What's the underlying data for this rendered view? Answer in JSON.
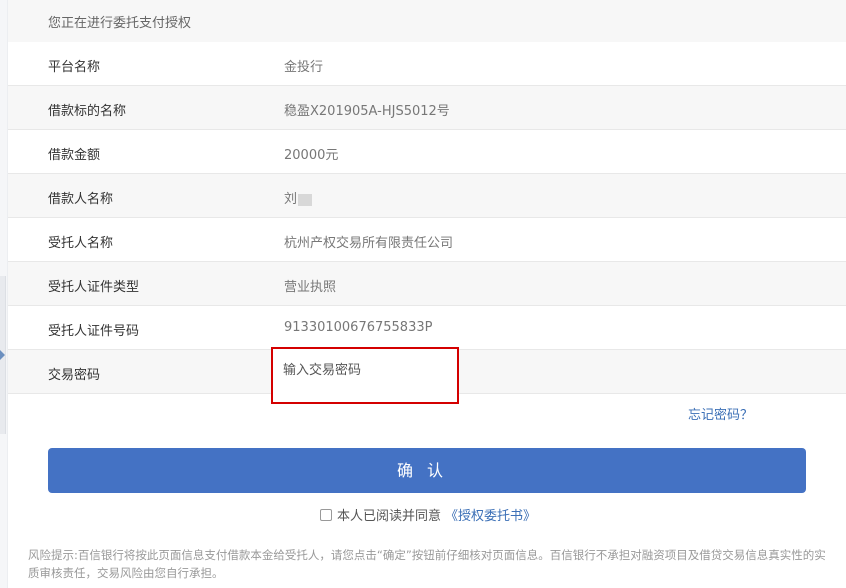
{
  "header": {
    "title": "您正在进行委托支付授权"
  },
  "rows": [
    {
      "label": "平台名称",
      "value": "金投行"
    },
    {
      "label": "借款标的名称",
      "value": "稳盈X201905A-HJS5012号"
    },
    {
      "label": "借款金额",
      "value": "20000元"
    },
    {
      "label": "借款人名称",
      "value": "刘"
    },
    {
      "label": "受托人名称",
      "value": "杭州产权交易所有限责任公司"
    },
    {
      "label": "受托人证件类型",
      "value": "营业执照"
    },
    {
      "label": "受托人证件号码",
      "value": "91330100676755833P"
    }
  ],
  "password": {
    "label": "交易密码",
    "placeholder": "输入交易密码"
  },
  "forgot_label": "忘记密码？",
  "confirm_label": "确认",
  "agreement": {
    "text": "本人已阅读并同意",
    "link": "《授权委托书》"
  },
  "risk_notice": "风险提示:百信银行将按此页面信息支付借款本金给受托人，请您点击“确定”按钮前仔细核对页面信息。百信银行不承担对融资项目及借贷交易信息真实性的实质审核责任，交易风险由您自行承担。",
  "colors": {
    "primary": "#4472c4",
    "link": "#3b6fb6",
    "highlight_border": "#d40000"
  }
}
